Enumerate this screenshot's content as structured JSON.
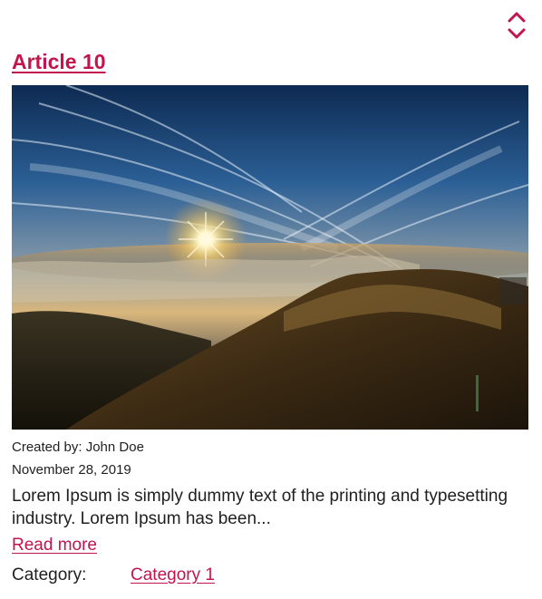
{
  "colors": {
    "accent": "#c4144e",
    "text": "#1f1f1f",
    "background": "#ffffff"
  },
  "toolbar": {
    "sort_icon": "chevron-up-down-icon"
  },
  "article": {
    "title": "Article 10",
    "image_icon": "mountain-sunrise-photo",
    "author": "Created by: John Doe",
    "date": "November 28, 2019",
    "excerpt": "Lorem Ipsum is simply dummy text of the printing and typesetting industry. Lorem Ipsum has been...",
    "read_more_label": "Read more",
    "category_label": "Category:",
    "category_value": "Category 1"
  }
}
